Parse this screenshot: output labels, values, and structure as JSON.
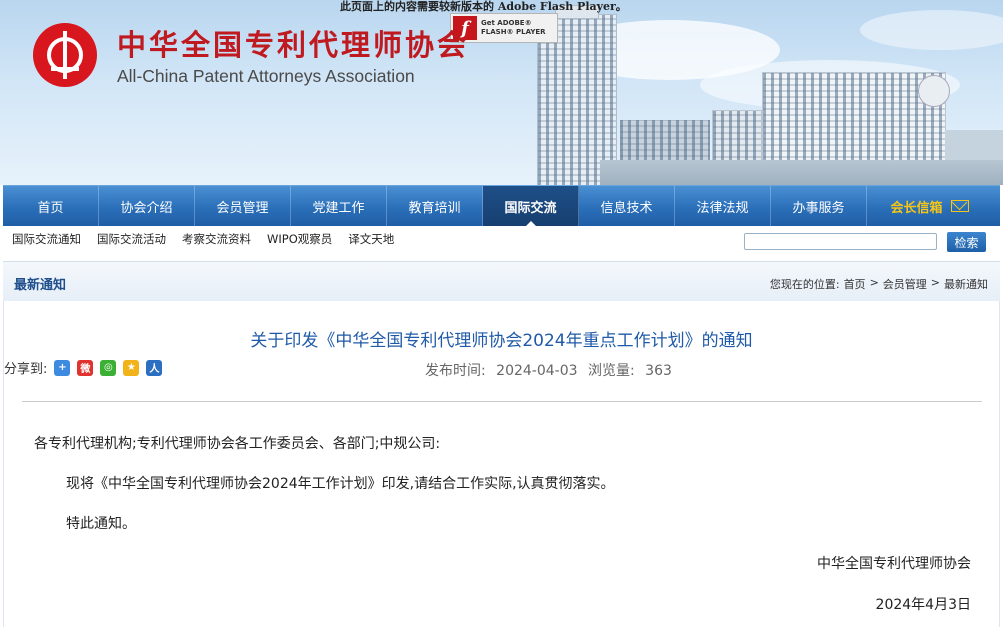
{
  "banner": {
    "flash_notice": "此页面上的内容需要较新版本的 Adobe Flash Player。",
    "flash_badge": {
      "line1": "Get ADOBE®",
      "line2": "FLASH® PLAYER"
    },
    "org_name_cn": "中华全国专利代理师协会",
    "org_name_en": "All-China Patent Attorneys Association"
  },
  "nav": {
    "items": [
      "首页",
      "协会介绍",
      "会员管理",
      "党建工作",
      "教育培训",
      "国际交流",
      "信息技术",
      "法律法规",
      "办事服务"
    ],
    "active": "国际交流",
    "mail_label": "会长信箱"
  },
  "subnav": {
    "items": [
      "国际交流通知",
      "国际交流活动",
      "考察交流资料",
      "WIPO观察员",
      "译文天地"
    ]
  },
  "search": {
    "placeholder": "",
    "button": "检索"
  },
  "section": {
    "title": "最新通知"
  },
  "breadcrumb": {
    "prefix": "您现在的位置:",
    "items": [
      "首页",
      "会员管理",
      "最新通知"
    ],
    "separator": ">"
  },
  "article": {
    "title": "关于印发《中华全国专利代理师协会2024年重点工作计划》的通知",
    "share_label": "分享到:",
    "publish_label": "发布时间:",
    "publish_date": "2024-04-03",
    "views_label": "浏览量:",
    "views": "363",
    "salutation": "各专利代理机构;专利代理师协会各工作委员会、各部门;中规公司:",
    "body": "现将《中华全国专利代理师协会2024年工作计划》印发,请结合工作实际,认真贯彻落实。",
    "closing": "特此通知。",
    "signature": "中华全国专利代理师协会",
    "date": "2024年4月3日"
  },
  "colors": {
    "nav": "#2b6fb9",
    "nav_active": "#163f70",
    "brand_red": "#c01a21",
    "title_blue": "#1f5aa8",
    "mail_yellow": "#f5c518"
  }
}
